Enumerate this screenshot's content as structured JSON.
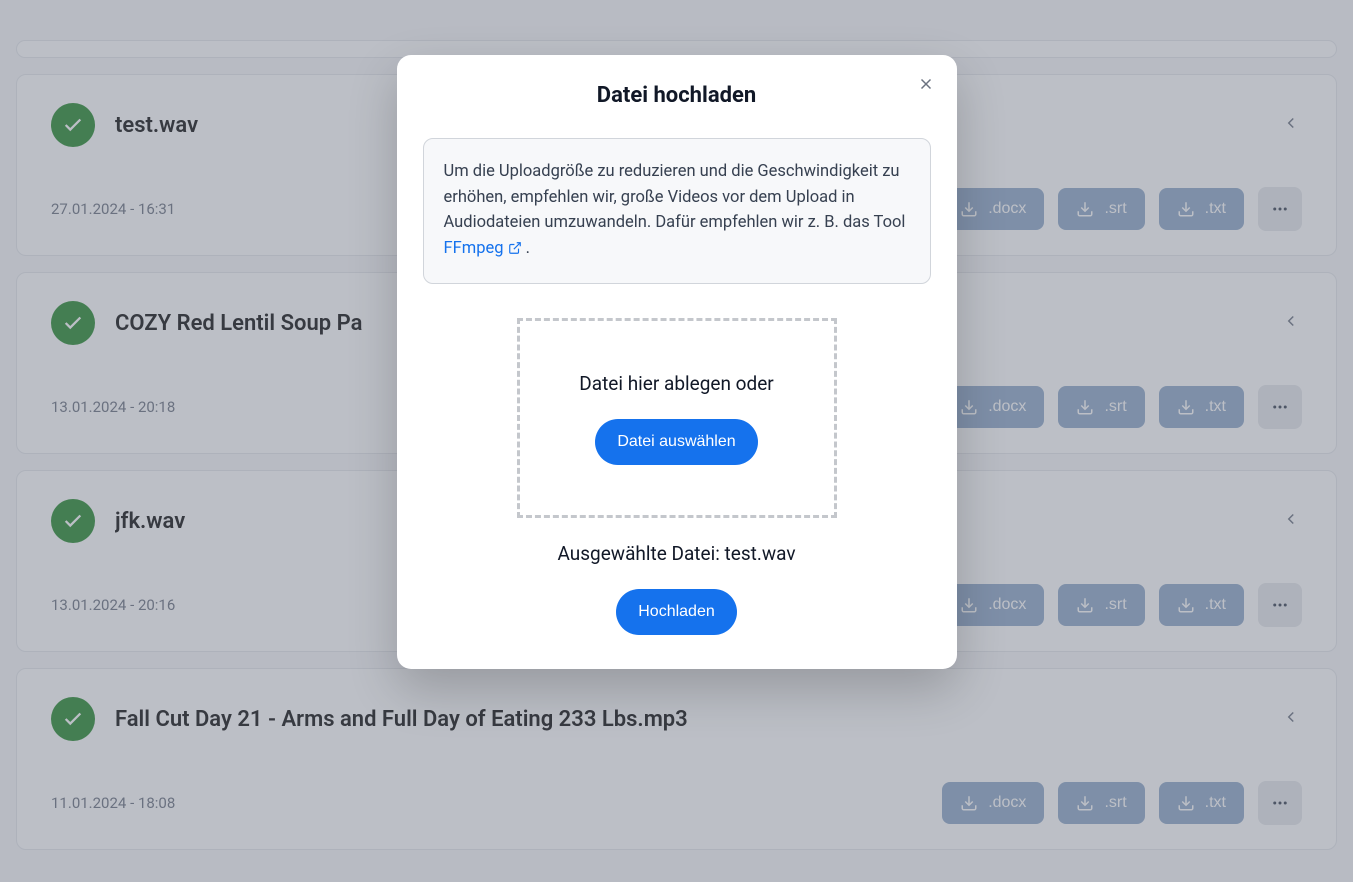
{
  "files": [
    {
      "name": "test.wav",
      "date": "27.01.2024 - 16:31"
    },
    {
      "name": "COZY Red Lentil Soup Pa",
      "date": "13.01.2024 - 20:18"
    },
    {
      "name": "jfk.wav",
      "date": "13.01.2024 - 20:16"
    },
    {
      "name": "Fall Cut Day 21 - Arms and Full Day of Eating 233 Lbs.mp3",
      "date": "11.01.2024 - 18:08"
    }
  ],
  "download_formats": [
    ".docx",
    ".srt",
    ".txt"
  ],
  "modal": {
    "title": "Datei hochladen",
    "info_text": "Um die Uploadgröße zu reduzieren und die Geschwindigkeit zu erhöhen, empfehlen wir, große Videos vor dem Upload in Audiodateien umzuwandeln. Dafür empfehlen wir z. B. das Tool ",
    "info_link_text": "FFmpeg",
    "info_trailing": " .",
    "drop_text": "Datei hier ablegen oder",
    "select_button": "Datei auswählen",
    "selected_label_prefix": "Ausgewählte Datei: ",
    "selected_file": "test.wav",
    "upload_button": "Hochladen"
  }
}
